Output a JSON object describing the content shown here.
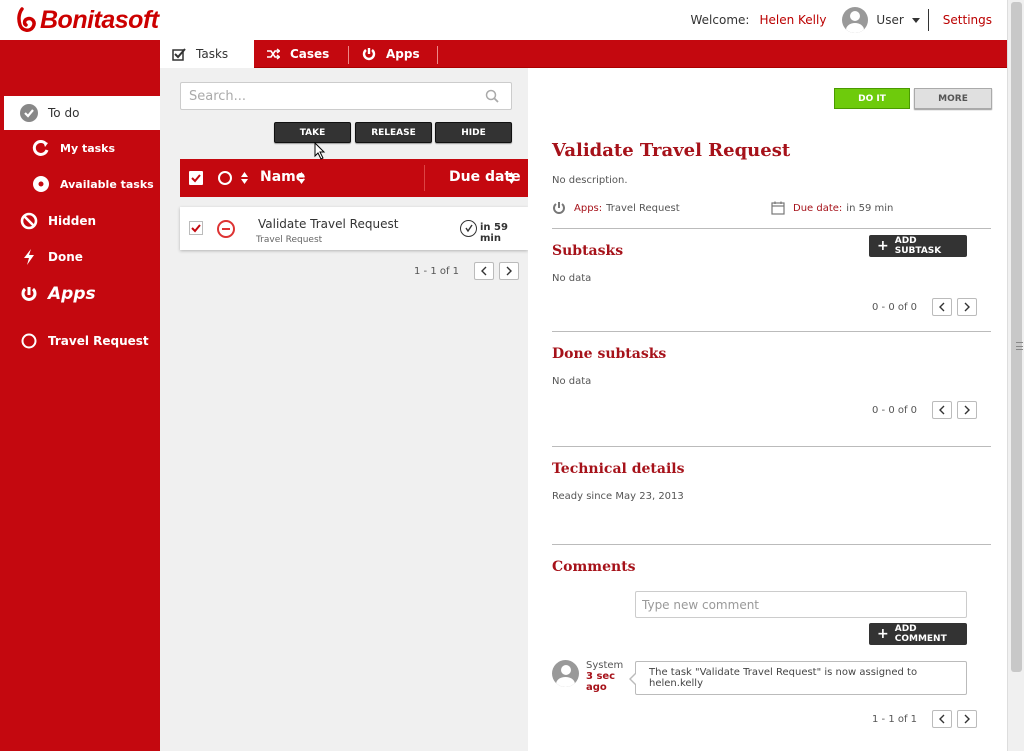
{
  "app": {
    "logo_text": "Bonitasoft"
  },
  "header": {
    "welcome_label": "Welcome:",
    "user_name": "Helen Kelly",
    "user_menu_label": "User",
    "settings_label": "Settings"
  },
  "tabs": [
    {
      "label": "Tasks",
      "icon": "check-square-icon",
      "active": true
    },
    {
      "label": "Cases",
      "icon": "shuffle-icon",
      "active": false
    },
    {
      "label": "Apps",
      "icon": "apps-icon",
      "active": false
    }
  ],
  "sidebar": {
    "items": [
      {
        "label": "To do",
        "icon": "check-circle-icon",
        "active": true
      },
      {
        "label": "My tasks",
        "icon": "refresh-icon"
      },
      {
        "label": "Available tasks",
        "icon": "dot-circle-icon"
      },
      {
        "label": "Hidden",
        "icon": "ban-icon"
      },
      {
        "label": "Done",
        "icon": "bolt-icon"
      },
      {
        "label": "Apps",
        "icon": "apps-icon"
      },
      {
        "label": "Travel Request",
        "icon": "circle-icon"
      }
    ]
  },
  "list": {
    "search_placeholder": "Search...",
    "actions": {
      "take": "TAKE",
      "release": "RELEASE",
      "hide": "HIDE"
    },
    "columns": {
      "name": "Name",
      "due": "Due date"
    },
    "rows": [
      {
        "name": "Validate Travel Request",
        "app": "Travel Request",
        "due": "in 59 min",
        "checked": true
      }
    ],
    "pager_text": "1 - 1 of 1"
  },
  "detail": {
    "do_it_label": "DO IT",
    "more_label": "MORE",
    "title": "Validate Travel Request",
    "description": "No description.",
    "apps_label": "Apps:",
    "apps_value": "Travel Request",
    "due_label": "Due date:",
    "due_value": "in 59 min",
    "subtasks": {
      "title": "Subtasks",
      "add_label": "ADD SUBTASK",
      "empty": "No data",
      "pager_text": "0 - 0 of 0"
    },
    "done_subtasks": {
      "title": "Done subtasks",
      "empty": "No data",
      "pager_text": "0 - 0 of 0"
    },
    "technical": {
      "title": "Technical details",
      "text": "Ready since May 23, 2013"
    },
    "comments": {
      "title": "Comments",
      "placeholder": "Type new comment",
      "add_label": "ADD COMMENT",
      "items": [
        {
          "author": "System",
          "time": "3 sec ago",
          "text": "The task \"Validate Travel Request\" is now assigned to helen.kelly"
        }
      ],
      "pager_text": "1 - 1 of 1"
    }
  },
  "colors": {
    "brand_red": "#c4080f",
    "title_red": "#a6121a",
    "doit_green": "#6ecb0c"
  }
}
